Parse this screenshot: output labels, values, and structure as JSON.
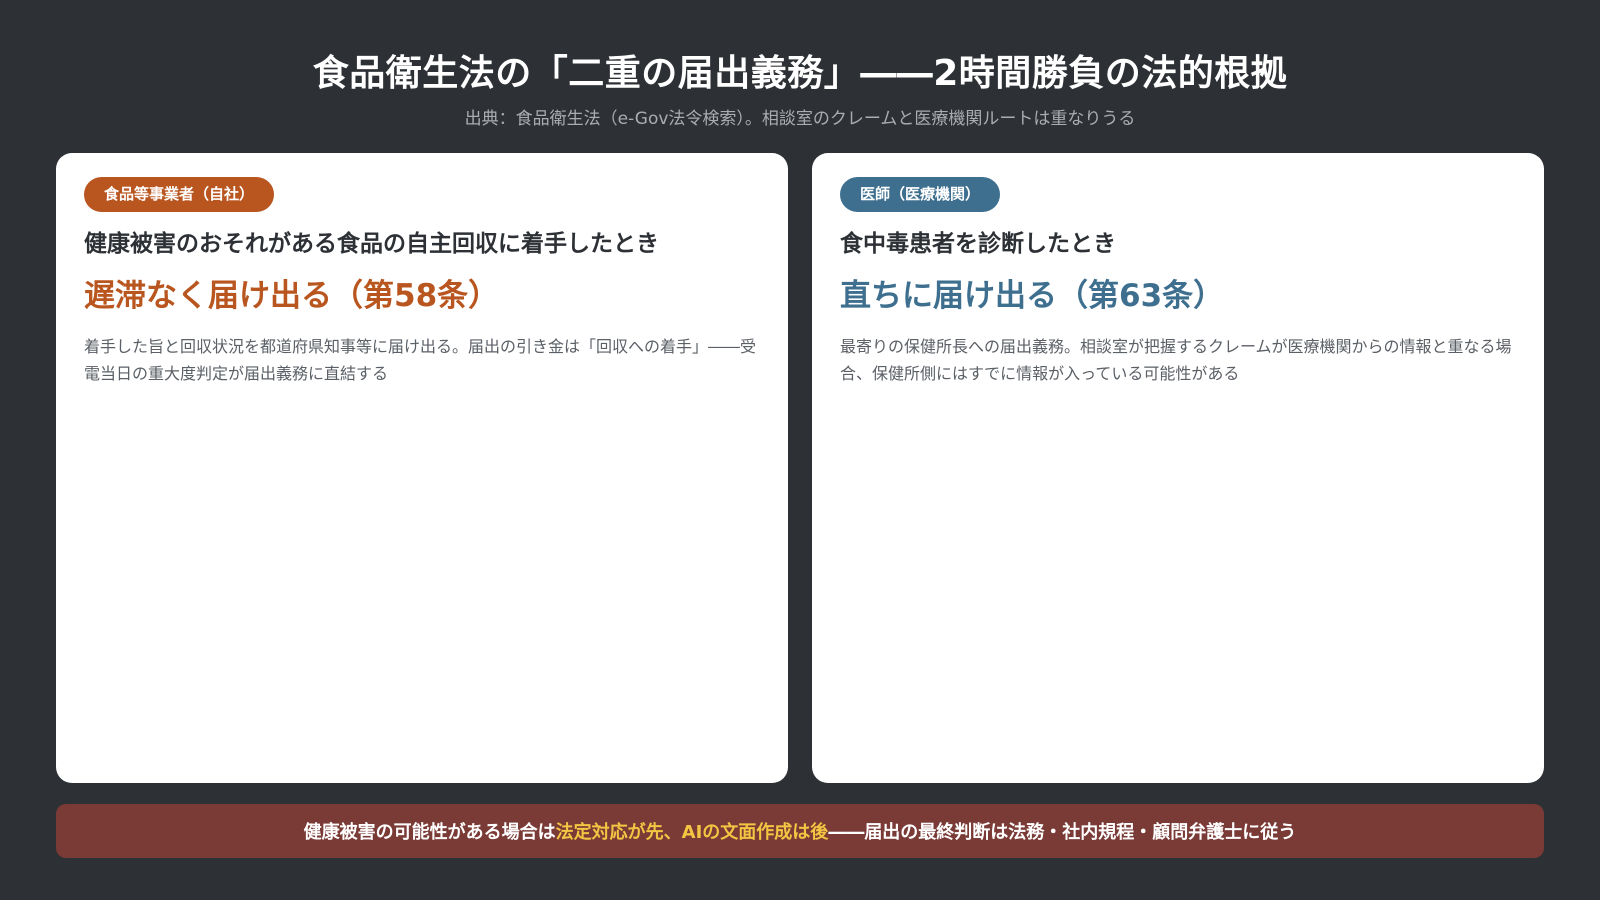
{
  "header": {
    "title": "食品衛生法の「二重の届出義務」――2時間勝負の法的根拠",
    "subtitle": "出典：食品衛生法（e-Gov法令検索）。相談室のクレームと医療機関ルートは重なりうる"
  },
  "cards": [
    {
      "badge": "食品等事業者（自社）",
      "condition": "健康被害のおそれがある食品の自主回収に着手したとき",
      "duty": "遅滞なく届け出る（第58条）",
      "description": "着手した旨と回収状況を都道府県知事等に届け出る。届出の引き金は「回収への着手」――受電当日の重大度判定が届出義務に直結する",
      "accent_color": "#b9561f"
    },
    {
      "badge": "医師（医療機関）",
      "condition": "食中毒患者を診断したとき",
      "duty": "直ちに届け出る（第63条）",
      "description": "最寄りの保健所長への届出義務。相談室が把握するクレームが医療機関からの情報と重なる場合、保健所側にはすでに情報が入っている可能性がある",
      "accent_color": "#3e6f8f"
    }
  ],
  "banner": {
    "text_before": "健康被害の可能性がある場合は",
    "highlight": "法定対応が先、AIの文面作成は後",
    "text_after": "――届出の最終判断は法務・社内規程・顧問弁護士に従う",
    "background_color": "#7a3a36",
    "highlight_color": "#f4c542"
  }
}
